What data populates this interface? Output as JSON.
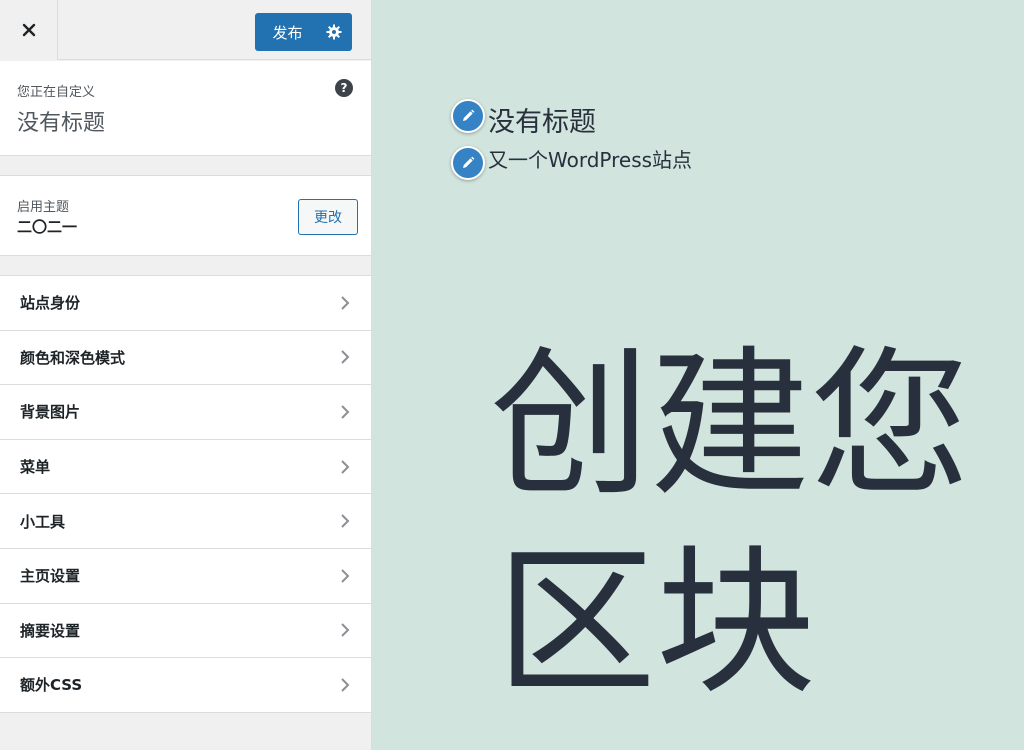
{
  "header": {
    "close_icon": "close-icon",
    "publish_label": "发布",
    "settings_icon": "gear-icon"
  },
  "info": {
    "subtitle": "您正在自定义",
    "title": "没有标题",
    "help_icon": "?"
  },
  "theme": {
    "subtitle": "启用主题",
    "name": "二〇二一",
    "change_label": "更改"
  },
  "menu": {
    "items": [
      {
        "label": "站点身份"
      },
      {
        "label": "颜色和深色模式"
      },
      {
        "label": "背景图片"
      },
      {
        "label": "菜单"
      },
      {
        "label": "小工具"
      },
      {
        "label": "主页设置"
      },
      {
        "label": "摘要设置"
      },
      {
        "label": "额外CSS"
      }
    ]
  },
  "preview": {
    "site_title": "没有标题",
    "site_tagline": "又一个WordPress站点",
    "headline_line1": "创建您",
    "headline_line2": "区块"
  },
  "colors": {
    "accent": "#2271b1",
    "preview_bg": "#d1e4dd",
    "text_dark": "#28303d"
  }
}
